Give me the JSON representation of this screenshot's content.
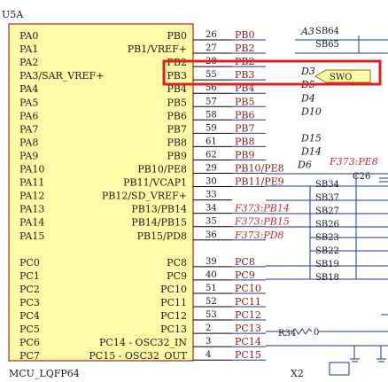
{
  "component": {
    "designator": "U5A",
    "part_name": "MCU_LQFP64",
    "body_color": "#fffca8",
    "border_color": "#8b0000",
    "left_pins": [
      "PA0",
      "PA1",
      "PA2",
      "PA3/SAR_VREF+",
      "PA4",
      "PA5",
      "PA6",
      "PA7",
      "PA8",
      "PA9",
      "PA10",
      "PA11",
      "PA12",
      "PA13",
      "PA14",
      "PA15",
      "",
      "PC0",
      "PC1",
      "PC2",
      "PC3",
      "PC4",
      "PC5",
      "PC6",
      "PC7"
    ],
    "right_pins": [
      "PB0",
      "PB1/VREF+",
      "PB2",
      "PB3",
      "PB4",
      "PB5",
      "PB6",
      "PB7",
      "PB8",
      "PB9",
      "PB10/PE8",
      "PB11/VCAP1",
      "PB12/SD_VREF+",
      "PB13/PB14",
      "PB14/PB15",
      "PB15/PD8",
      "",
      "PC8",
      "PC9",
      "PC10",
      "PC11",
      "PC12",
      "PC13",
      "PC14 - OSC32_IN",
      "PC15 - OSC32_OUT"
    ]
  },
  "pin_numbers": [
    "26",
    "27",
    "28",
    "55",
    "56",
    "57",
    "58",
    "59",
    "61",
    "62",
    "29",
    "30",
    "33",
    "34",
    "35",
    "36",
    "",
    "39",
    "40",
    "51",
    "52",
    "53",
    "2",
    "3",
    "4"
  ],
  "nets": [
    "PB0",
    "PB2",
    "PB2",
    "PB3",
    "PB4",
    "PB5",
    "PB6",
    "PB7",
    "PB8",
    "PB9",
    "PB10/PE8",
    "PB11/PE9",
    "",
    "F373:PB14",
    "F373:PB15",
    "F373:PD8",
    "",
    "PC8",
    "PC9",
    "PC10",
    "PC11",
    "PC12",
    "PC13",
    "PC14",
    "PC15"
  ],
  "net_alt": [
    "",
    "",
    "",
    "",
    "",
    "",
    "",
    "",
    "",
    "",
    "",
    "",
    "",
    "",
    "",
    "",
    "",
    "",
    "",
    "",
    "",
    "",
    "",
    "",
    ""
  ],
  "d_labels": [
    "A3",
    "",
    "",
    "D3",
    "D5",
    "D4",
    "D10",
    "",
    "D15",
    "D14",
    "D6",
    "",
    "",
    "",
    "",
    "",
    "",
    "",
    "",
    "",
    "",
    "",
    "",
    "",
    ""
  ],
  "extra_label": "F373:PE8",
  "solder_bridges": [
    "SB64",
    "SB65",
    "SB34",
    "SB37",
    "SB27",
    "SB26",
    "SB23",
    "SB22",
    "SB19",
    "SB18"
  ],
  "port_label": "SWO",
  "highlight_color": "#e02020",
  "capacitor": "C26",
  "resistor": {
    "designator": "R34",
    "value": "0"
  },
  "crystal": "X2"
}
